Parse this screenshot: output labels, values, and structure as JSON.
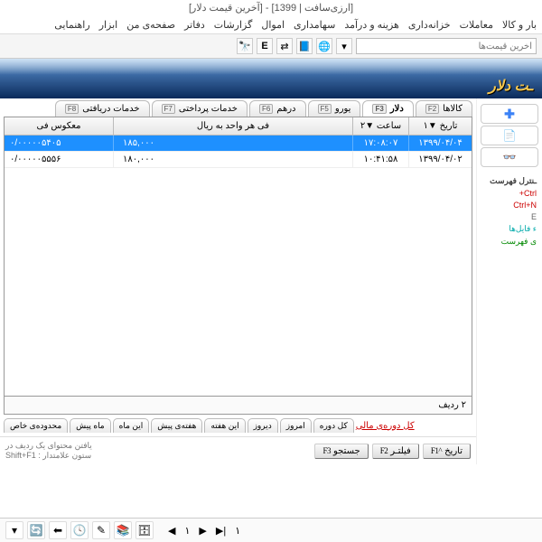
{
  "title": "[ارزی‌سافت | 1399] - [آخرین قیمت دلار]",
  "menu": [
    "بار و کالا",
    "معاملات",
    "خزانه‌داری",
    "هزینه و درآمد",
    "سهامداری",
    "اموال",
    "گزارشات",
    "دفاتر",
    "صفحه‌ی من",
    "ابزار",
    "راهنمایی"
  ],
  "search_placeholder": "آخرین قیمت‌ها",
  "banner": "ـت دلار",
  "tabs": [
    {
      "label": "کالاها",
      "fk": "F2"
    },
    {
      "label": "دلار",
      "fk": "F3",
      "active": true
    },
    {
      "label": "یورو",
      "fk": "F5"
    },
    {
      "label": "درهم",
      "fk": "F6"
    },
    {
      "label": "خدمات پرداختی",
      "fk": "F7"
    },
    {
      "label": "خدمات دریافتی",
      "fk": "F8"
    }
  ],
  "columns": {
    "date": "تاریخ ▼۱",
    "time": "ساعت ▼۲",
    "rate": "فی هر واحد به ریال",
    "inv": "معکوس فی"
  },
  "rows": [
    {
      "date": "۱۳۹۹/۰۴/۰۴",
      "time": "۱۷:۰۸:۰۷",
      "rate": "۱۸۵,۰۰۰",
      "inv": "۰/۰۰۰۰۰۵۴۰۵",
      "sel": true
    },
    {
      "date": "۱۳۹۹/۰۴/۰۲",
      "time": "۱۰:۴۱:۵۸",
      "rate": "۱۸۰,۰۰۰",
      "inv": "۰/۰۰۰۰۰۵۵۵۶"
    }
  ],
  "row_count": "۲ ردیف",
  "filter_tabs": [
    "کل دوره",
    "امروز",
    "دیروز",
    "این هفته",
    "هفته‌ی پیش",
    "این ماه",
    "ماه پیش",
    "محدوده‌ی خاص"
  ],
  "period_link": "کل دوره‌ی مالی",
  "func_btns": [
    {
      "label": "تاریخ",
      "fk": "^F1"
    },
    {
      "label": "فیلتـر",
      "fk": "F2"
    },
    {
      "label": "جستجو",
      "fk": "F3"
    }
  ],
  "find_hint": "یافتن محتوای یک ردیف در\nستون علامتدار : Shift+F1",
  "shortcuts": {
    "hdr": "ـنترل فهرست",
    "i1": "Ctrl+",
    "i2": "Ctrl+N",
    "i3": "E",
    "i4": "ء فایل‌ها",
    "i5": "ی فهرست"
  },
  "pager": {
    "cur": "١",
    "total": "١"
  }
}
